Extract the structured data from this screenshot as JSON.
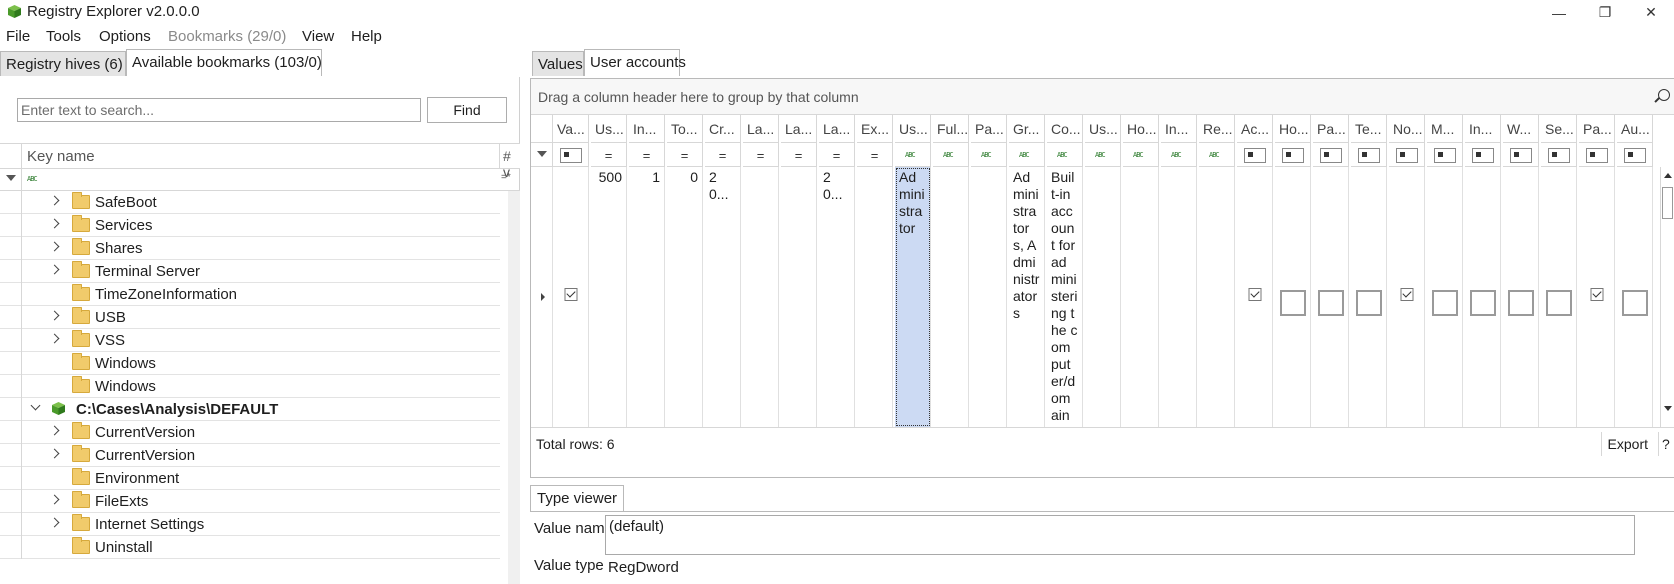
{
  "window": {
    "title": "Registry Explorer v2.0.0.0",
    "minimize": "—",
    "restore": "❐",
    "close": "✕"
  },
  "menu": {
    "file": "File",
    "tools": "Tools",
    "options": "Options",
    "bookmarks": "Bookmarks (29/0)",
    "view": "View",
    "help": "Help"
  },
  "left": {
    "tabs": [
      "Registry hives (6)",
      "Available bookmarks (103/0)"
    ],
    "search_placeholder": "Enter text to search...",
    "find_label": "Find",
    "key_name_header": "Key name",
    "count_header": "# v",
    "tree": [
      {
        "label": "SafeBoot",
        "expandable": true
      },
      {
        "label": "Services",
        "expandable": true
      },
      {
        "label": "Shares",
        "expandable": true
      },
      {
        "label": "Terminal Server",
        "expandable": true
      },
      {
        "label": "TimeZoneInformation",
        "expandable": false
      },
      {
        "label": "USB",
        "expandable": true
      },
      {
        "label": "VSS",
        "expandable": true
      },
      {
        "label": "Windows",
        "expandable": false
      },
      {
        "label": "Windows",
        "expandable": false
      },
      {
        "label": "C:\\Cases\\Analysis\\DEFAULT",
        "expandable": true,
        "hive": true
      },
      {
        "label": "CurrentVersion",
        "expandable": true
      },
      {
        "label": "CurrentVersion",
        "expandable": true
      },
      {
        "label": "Environment",
        "expandable": false
      },
      {
        "label": "FileExts",
        "expandable": true
      },
      {
        "label": "Internet Settings",
        "expandable": true
      },
      {
        "label": "Uninstall",
        "expandable": false
      }
    ]
  },
  "right": {
    "tabs": [
      "Values",
      "User accounts"
    ],
    "group_hint": "Drag a column header here to group by that column",
    "columns": [
      "Va...",
      "Us...",
      "In...",
      "To...",
      "Cr...",
      "La...",
      "La...",
      "La...",
      "Ex...",
      "Us...",
      "Ful...",
      "Pa...",
      "Gr...",
      "Co...",
      "Us...",
      "Ho...",
      "In...",
      "Re...",
      "Ac...",
      "Ho...",
      "Pa...",
      "Te...",
      "No...",
      "M...",
      "In...",
      "W...",
      "Se...",
      "Pa...",
      "Au..."
    ],
    "row": {
      "user_id": "500",
      "invalid_login_count": "1",
      "total_login_count": "0",
      "created": "20...",
      "last_pw_change": "20...",
      "user_name": "Administrator",
      "groups": "Administrators, Administrators",
      "comment": "Built-in account for administering the computer/domain"
    },
    "total_rows": "Total rows: 6",
    "export_label": "Export",
    "help_label": "?"
  },
  "type_viewer": {
    "tab_label": "Type viewer",
    "value_name_label": "Value name",
    "value_name": "(default)",
    "value_type_label": "Value type",
    "value_type": "RegDword"
  }
}
